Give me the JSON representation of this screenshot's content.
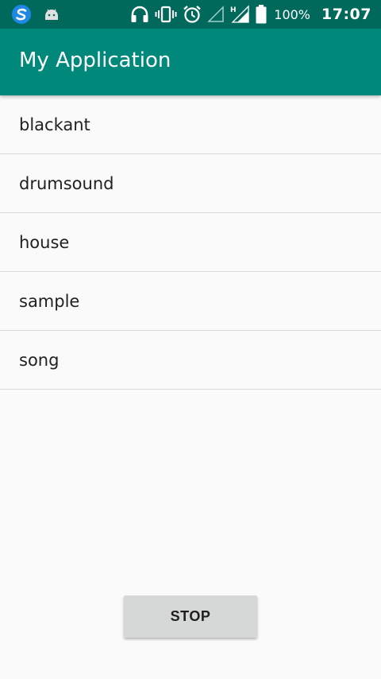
{
  "status_bar": {
    "icons_left": [
      "app-s-icon",
      "android-icon"
    ],
    "icons_right": [
      "headphones-icon",
      "vibrate-icon",
      "alarm-icon",
      "signal-empty-icon",
      "signal-h-icon",
      "battery-icon"
    ],
    "battery_text": "100%",
    "time": "17:07",
    "background_color": "#00695c"
  },
  "app_bar": {
    "title": "My Application",
    "background_color": "#00897b"
  },
  "list": {
    "items": [
      {
        "label": "blackant"
      },
      {
        "label": "drumsound"
      },
      {
        "label": "house"
      },
      {
        "label": "sample"
      },
      {
        "label": "song"
      }
    ]
  },
  "stop_button": {
    "label": "STOP"
  }
}
